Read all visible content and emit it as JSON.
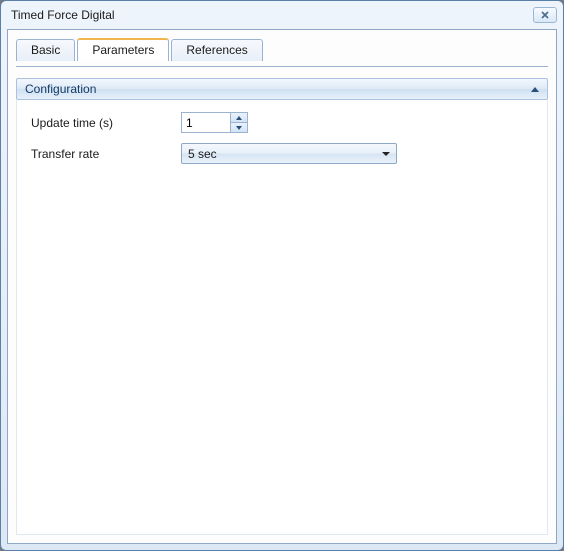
{
  "window": {
    "title": "Timed Force Digital"
  },
  "tabs": {
    "basic": "Basic",
    "parameters": "Parameters",
    "references": "References",
    "active": "parameters"
  },
  "section": {
    "title": "Configuration"
  },
  "fields": {
    "update_time_label": "Update time (s)",
    "update_time_value": "1",
    "transfer_rate_label": "Transfer rate",
    "transfer_rate_value": "5 sec"
  }
}
